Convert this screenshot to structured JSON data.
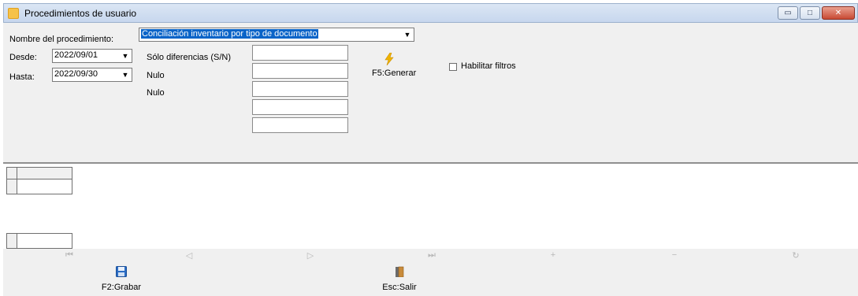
{
  "window": {
    "title": "Procedimientos de usuario",
    "controls": {
      "minimize": "▭",
      "maximize": "□",
      "close": "✕"
    }
  },
  "form": {
    "procedure_label": "Nombre del procedimiento:",
    "procedure_value": "Conciliación inventario por tipo de documento",
    "desde_label": "Desde:",
    "desde_value": "2022/09/01",
    "hasta_label": "Hasta:",
    "hasta_value": "2022/09/30",
    "param_labels": [
      "Sólo diferencias (S/N)",
      "Nulo",
      "Nulo"
    ],
    "param_values": [
      "",
      "",
      "",
      "",
      ""
    ],
    "generate_label": "F5:Generar",
    "filters_label": "Habilitar filtros",
    "filters_checked": false
  },
  "footer": {
    "save_label": "F2:Grabar",
    "exit_label": "Esc:Salir"
  },
  "icons": {
    "app": "form-icon",
    "generate": "lightning-icon",
    "save": "floppy-disk-icon",
    "exit": "door-icon",
    "nav": [
      "first-record-icon",
      "prev-record-icon",
      "next-record-icon",
      "last-record-icon",
      "insert-record-icon",
      "delete-record-icon",
      "refresh-icon"
    ]
  },
  "colors": {
    "selection": "#0a64c8",
    "generate_icon": "#f0b400",
    "save_icon": "#2b6cc4",
    "exit_icon": "#c88a3a"
  }
}
